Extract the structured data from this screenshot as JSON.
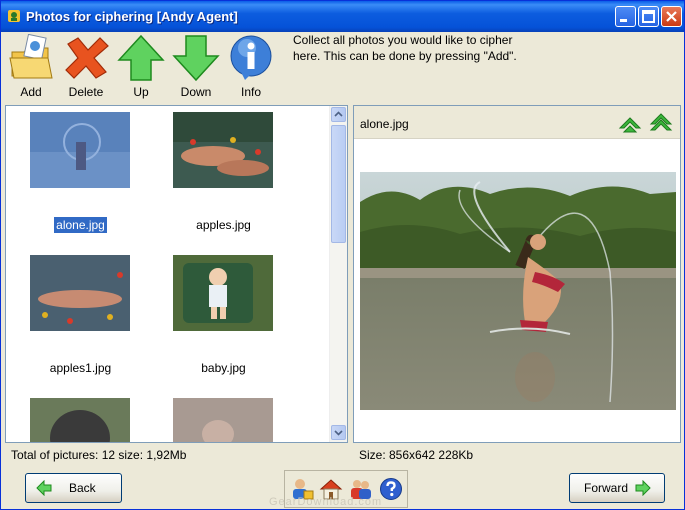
{
  "window": {
    "title": "Photos for ciphering [Andy Agent]"
  },
  "toolbar": {
    "add": "Add",
    "delete": "Delete",
    "up": "Up",
    "down": "Down",
    "info": "Info",
    "hint": "Collect all photos you would like to cipher here. This can be done by pressing \"Add\"."
  },
  "thumbnails": [
    {
      "name": "alone.jpg",
      "selected": true
    },
    {
      "name": "apples.jpg"
    },
    {
      "name": "apples1.jpg"
    },
    {
      "name": "baby.jpg"
    },
    {
      "name": ""
    },
    {
      "name": ""
    }
  ],
  "status_left": "Total of pictures: 12 size: 1,92Mb",
  "preview": {
    "filename": "alone.jpg",
    "info": "Size: 856x642  228Kb"
  },
  "buttons": {
    "back": "Back",
    "forward": "Forward"
  },
  "watermark": "GearDownload.com",
  "colors": {
    "title_bar": "#0552d8",
    "selection": "#316ac5",
    "arrow_green": "#3cb83c"
  }
}
